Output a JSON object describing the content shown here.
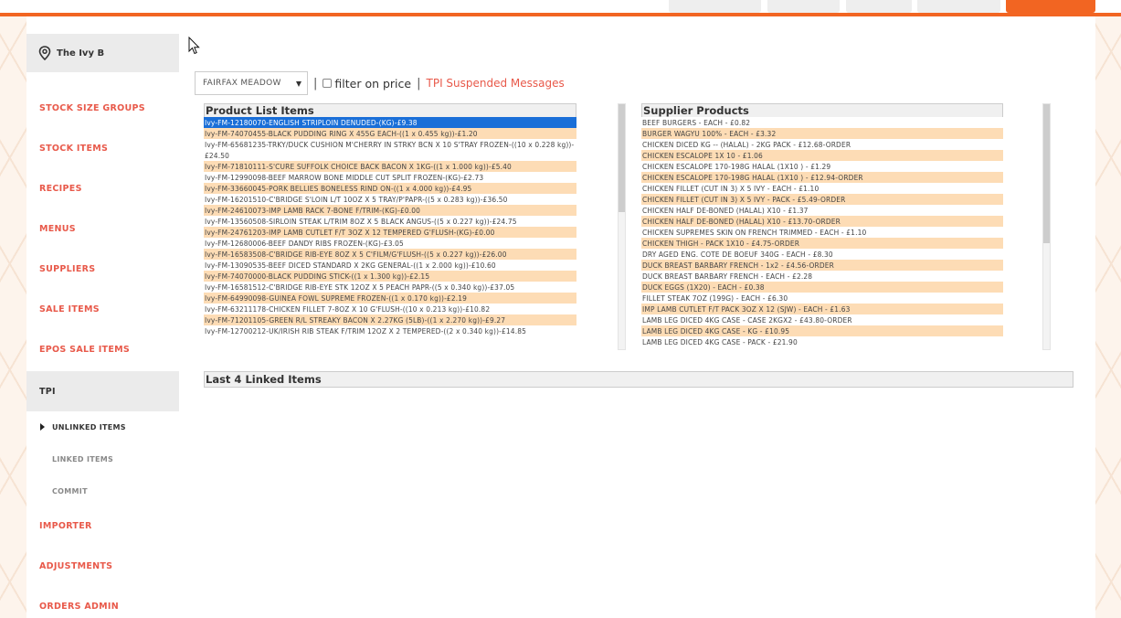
{
  "colors": {
    "accent": "#f26522",
    "nav_link": "#e8594a",
    "row_alt": "#fddcb5",
    "row_selected": "#1a6fd8"
  },
  "location": {
    "name": "The Ivy B",
    "icon": "location-pin-icon"
  },
  "sidebar": {
    "items": [
      {
        "label": "STOCK SIZE GROUPS"
      },
      {
        "label": "STOCK ITEMS"
      },
      {
        "label": "RECIPES"
      },
      {
        "label": "MENUS"
      },
      {
        "label": "SUPPLIERS"
      },
      {
        "label": "SALE ITEMS"
      },
      {
        "label": "EPOS SALE ITEMS"
      },
      {
        "label": "TPI"
      },
      {
        "label": "IMPORTER"
      },
      {
        "label": "ADJUSTMENTS"
      },
      {
        "label": "ORDERS ADMIN"
      }
    ],
    "tpi_sub": [
      {
        "label": "UNLINKED ITEMS"
      },
      {
        "label": "LINKED ITEMS"
      },
      {
        "label": "COMMIT"
      }
    ]
  },
  "controls": {
    "supplier_select": "FAIRFAX MEADOW",
    "separator": "|",
    "filter_label": "filter on price",
    "tpi_link": "TPI Suspended Messages"
  },
  "product_list": {
    "title": "Product List Items",
    "rows": [
      "Ivy-FM-12180070-ENGLISH STRIPLOIN DENUDED-(KG)-£9.38",
      "Ivy-FM-74070455-BLACK PUDDING RING X 455G EACH-((1 x 0.455 kg))-£1.20",
      "Ivy-FM-65681235-TRKY/DUCK CUSHION M'CHERRY IN STRKY BCN X 10 S'TRAY FROZEN-((10 x 0.228 kg))-£24.50",
      "Ivy-FM-71810111-S'CURE SUFFOLK CHOICE BACK BACON X 1KG-((1 x 1.000 kg))-£5.40",
      "Ivy-FM-12990098-BEEF MARROW BONE MIDDLE CUT SPLIT FROZEN-(KG)-£2.73",
      "Ivy-FM-33660045-PORK BELLIES BONELESS RIND ON-((1 x 4.000 kg))-£4.95",
      "Ivy-FM-16201510-C'BRIDGE S'LOIN L/T 10OZ X 5 TRAY/P'PAPR-((5 x 0.283 kg))-£36.50",
      "Ivy-FM-24610073-IMP LAMB RACK 7-BONE F/TRIM-(KG)-£0.00",
      "Ivy-FM-13560508-SIRLOIN STEAK L/TRIM 8OZ X 5 BLACK ANGUS-((5 x 0.227 kg))-£24.75",
      "Ivy-FM-24761203-IMP LAMB CUTLET F/T 3OZ X 12 TEMPERED G'FLUSH-(KG)-£0.00",
      "Ivy-FM-12680006-BEEF DANDY RIBS FROZEN-(KG)-£3.05",
      "Ivy-FM-16583508-C'BRIDGE RIB-EYE 8OZ X 5 C'FILM/G'FLUSH-((5 x 0.227 kg))-£26.00",
      "Ivy-FM-13090535-BEEF DICED STANDARD X 2KG GENERAL-((1 x 2.000 kg))-£10.60",
      "Ivy-FM-74070000-BLACK PUDDING STICK-((1 x 1.300 kg))-£2.15",
      "Ivy-FM-16581512-C'BRIDGE RIB-EYE STK 12OZ X 5 PEACH PAPR-((5 x 0.340 kg))-£37.05",
      "Ivy-FM-64990098-GUINEA FOWL SUPREME FROZEN-((1 x 0.170 kg))-£2.19",
      "Ivy-FM-63211178-CHICKEN FILLET 7-8OZ X 10 G'FLUSH-((10 x 0.213 kg))-£10.82",
      "Ivy-FM-71201105-GREEN R/L STREAKY BACON X 2.27KG (5LB)-((1 x 2.270 kg))-£9.27",
      "Ivy-FM-12700212-UK/IRISH RIB STEAK F/TRIM 12OZ X 2 TEMPERED-((2 x 0.340 kg))-£14.85"
    ]
  },
  "supplier_products": {
    "title": "Supplier Products",
    "rows": [
      "BEEF BURGERS - EACH - £0.82",
      "BURGER WAGYU 100% - EACH - £3.32",
      "CHICKEN DICED KG -- (HALAL) - 2KG PACK - £12.68-ORDER",
      "CHICKEN ESCALOPE 1X 10 - £1.06",
      "CHICKEN ESCALOPE 170-198G HALAL (1X10 ) - £1.29",
      "CHICKEN ESCALOPE 170-198G HALAL (1X10 ) - £12.94-ORDER",
      "CHICKEN FILLET (CUT IN 3) X 5 IVY - EACH - £1.10",
      "CHICKEN FILLET (CUT IN 3) X 5 IVY - PACK - £5.49-ORDER",
      "CHICKEN HALF DE-BONED (HALAL) X10 - £1.37",
      "CHICKEN HALF DE-BONED (HALAL) X10 - £13.70-ORDER",
      "CHICKEN SUPREMES SKIN ON FRENCH TRIMMED - EACH - £1.10",
      "CHICKEN THIGH - PACK 1X10 - £4.75-ORDER",
      "DRY AGED ENG. COTE DE BOEUF 340G - EACH - £8.30",
      "DUCK BREAST BARBARY FRENCH - 1x2 - £4.56-ORDER",
      "DUCK BREAST BARBARY FRENCH - EACH - £2.28",
      "DUCK EGGS (1X20) - EACH - £0.38",
      "FILLET STEAK 7OZ (199G) - EACH - £6.30",
      "IMP LAMB CUTLET F/T PACK 3OZ X 12 (SJW) - EACH - £1.63",
      "LAMB LEG DICED 4KG CASE - CASE 2KGX2 - £43.80-ORDER",
      "LAMB LEG DICED 4KG CASE - KG - £10.95",
      "LAMB LEG DICED 4KG CASE - PACK - £21.90"
    ]
  },
  "last_linked": {
    "title": "Last 4 Linked Items"
  }
}
